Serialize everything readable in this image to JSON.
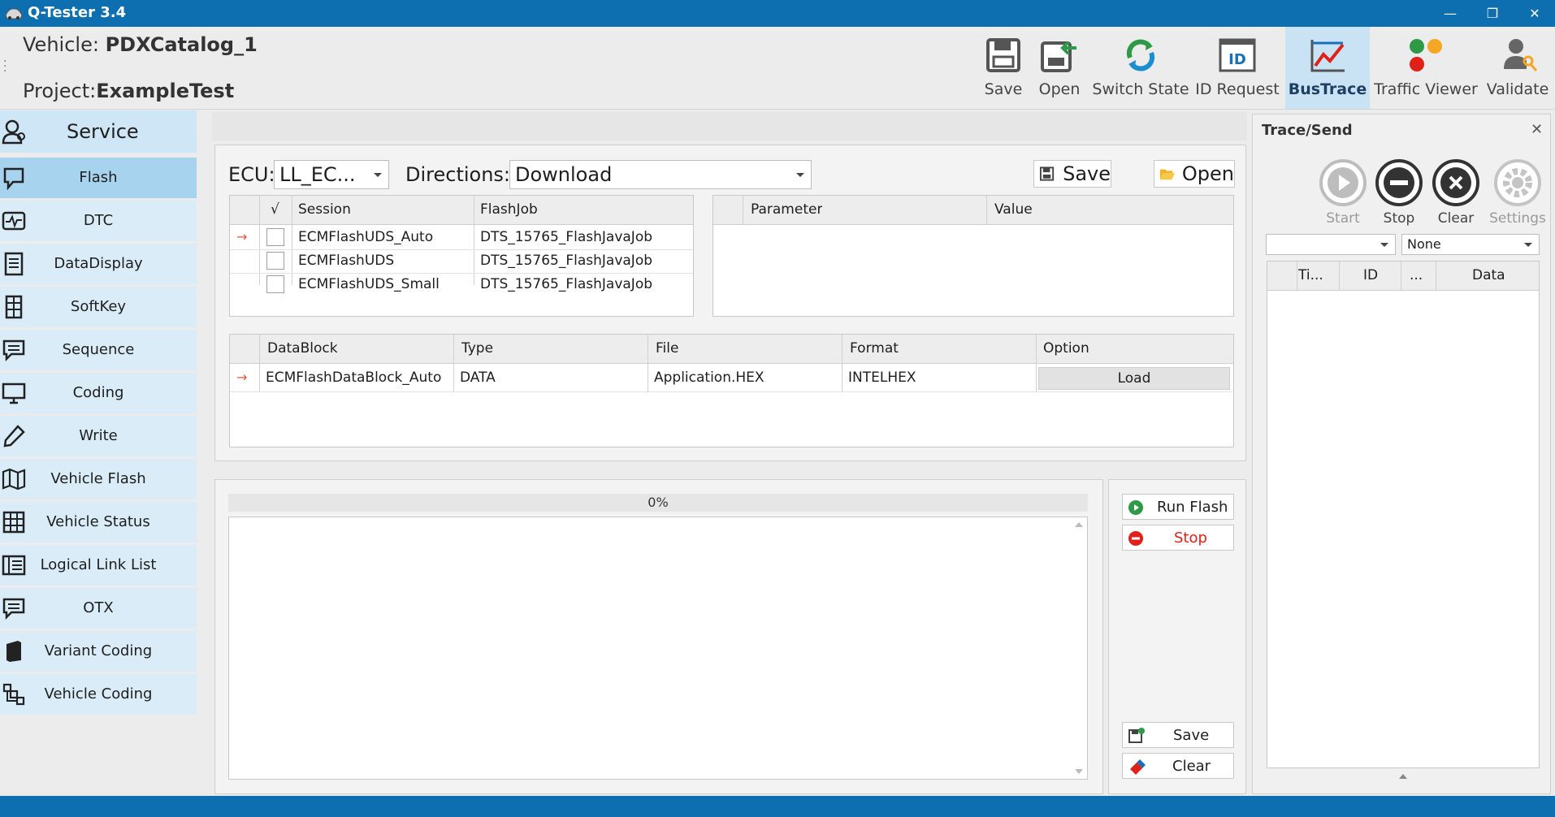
{
  "window": {
    "title": "Q-Tester  3.4",
    "minimize": "—",
    "restore": "❐",
    "close": "✕"
  },
  "header": {
    "vehicle_label": "Vehicle:",
    "vehicle_value": "PDXCatalog_1",
    "project_label": "Project:",
    "project_value": "ExampleTest"
  },
  "toolbar": [
    {
      "label": "Save",
      "icon": "save-icon"
    },
    {
      "label": "Open",
      "icon": "open-icon"
    },
    {
      "label": "Switch State",
      "icon": "switch-state-icon"
    },
    {
      "label": "ID Request",
      "icon": "id-request-icon"
    },
    {
      "label": "BusTrace",
      "icon": "bustrace-icon",
      "active": true
    },
    {
      "label": "Traffic Viewer",
      "icon": "traffic-viewer-icon"
    },
    {
      "label": "Validate",
      "icon": "validate-icon"
    }
  ],
  "sidebar": {
    "heading": "Service",
    "items": [
      {
        "label": "Flash",
        "icon": "flash-icon",
        "selected": true
      },
      {
        "label": "DTC",
        "icon": "dtc-icon"
      },
      {
        "label": "DataDisplay",
        "icon": "data-display-icon"
      },
      {
        "label": "SoftKey",
        "icon": "softkey-icon"
      },
      {
        "label": "Sequence",
        "icon": "sequence-icon"
      },
      {
        "label": "Coding",
        "icon": "coding-icon"
      },
      {
        "label": "Write",
        "icon": "write-icon"
      },
      {
        "label": "Vehicle Flash",
        "icon": "vehicle-flash-icon"
      },
      {
        "label": "Vehicle Status",
        "icon": "vehicle-status-icon"
      },
      {
        "label": "Logical Link List",
        "icon": "logical-link-list-icon"
      },
      {
        "label": "OTX",
        "icon": "otx-icon"
      },
      {
        "label": "Variant Coding",
        "icon": "variant-coding-icon"
      },
      {
        "label": "Vehicle Coding",
        "icon": "vehicle-coding-icon"
      }
    ]
  },
  "flash": {
    "ecu_label": "ECU:",
    "ecu_value": "LL_EC...",
    "directions_label": "Directions:",
    "directions_value": "Download",
    "save_label": "Save",
    "open_label": "Open",
    "session_table": {
      "check_header": "√",
      "headers": [
        "Session",
        "FlashJob"
      ],
      "rows": [
        {
          "session": "ECMFlashUDS_Auto",
          "flashjob": "DTS_15765_FlashJavaJob",
          "current": true
        },
        {
          "session": "ECMFlashUDS",
          "flashjob": "DTS_15765_FlashJavaJob"
        },
        {
          "session": "ECMFlashUDS_Small",
          "flashjob": "DTS_15765_FlashJavaJob"
        }
      ]
    },
    "param_table": {
      "headers": [
        "Parameter",
        "Value"
      ]
    },
    "datablock_table": {
      "headers": [
        "DataBlock",
        "Type",
        "File",
        "Format",
        "Option"
      ],
      "rows": [
        {
          "datablock": "ECMFlashDataBlock_Auto",
          "type": "DATA",
          "file": "Application.HEX",
          "format": "INTELHEX",
          "option": "Load"
        }
      ]
    },
    "progress": {
      "value": 0,
      "label": "0%"
    },
    "run_flash_label": "Run Flash",
    "stop_label": "Stop",
    "log_save_label": "Save",
    "log_clear_label": "Clear",
    "colors": {
      "stop_text": "#e0211a",
      "run_green": "#2e9a47",
      "stop_red": "#e0211a"
    }
  },
  "trace": {
    "title": "Trace/Send",
    "close": "✕",
    "buttons": [
      {
        "label": "Start",
        "icon": "play-icon",
        "enabled": false
      },
      {
        "label": "Stop",
        "icon": "stop-icon",
        "enabled": true
      },
      {
        "label": "Clear",
        "icon": "clear-icon",
        "enabled": true
      },
      {
        "label": "Settings",
        "icon": "settings-icon",
        "enabled": false
      }
    ],
    "filter_left": "",
    "filter_right": "None",
    "table_headers": [
      "Ti...",
      "ID",
      "...",
      "Data"
    ]
  }
}
